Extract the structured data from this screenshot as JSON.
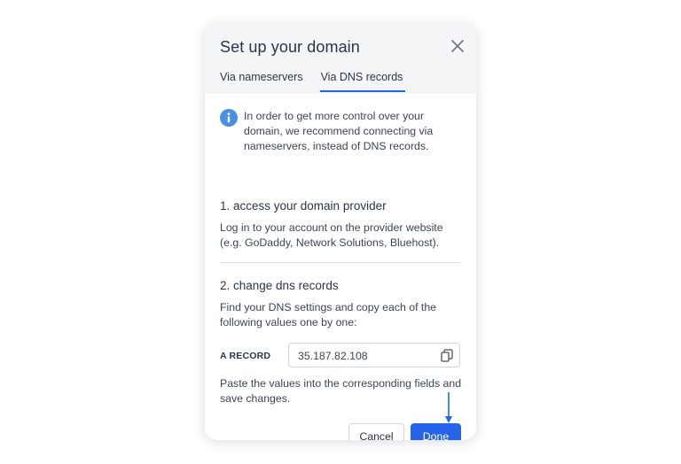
{
  "modal": {
    "title": "Set up your domain",
    "close_icon": "close-icon",
    "tabs": [
      {
        "label": "Via nameservers",
        "active": false
      },
      {
        "label": "Via DNS records",
        "active": true
      }
    ]
  },
  "info": {
    "icon": "info-icon",
    "text": "In order to get more control over your domain, we recommend connecting via nameservers, instead of DNS records."
  },
  "step1": {
    "title": "1. access your domain provider",
    "text": "Log in to your account on the provider website (e.g. GoDaddy, Network Solutions, Bluehost)."
  },
  "step2": {
    "title": "2. change dns records",
    "text": "Find your DNS settings and copy each of the following values one by one:",
    "record": {
      "label": "A RECORD",
      "value": "35.187.82.108",
      "copy_icon": "copy-icon"
    },
    "footer_text": "Paste the values into the corresponding fields and save changes."
  },
  "actions": {
    "cancel_label": "Cancel",
    "done_label": "Done"
  },
  "colors": {
    "accent": "#2563eb",
    "info": "#4a90e2",
    "header_bg": "#f4f5f7",
    "text": "#2b3644"
  }
}
